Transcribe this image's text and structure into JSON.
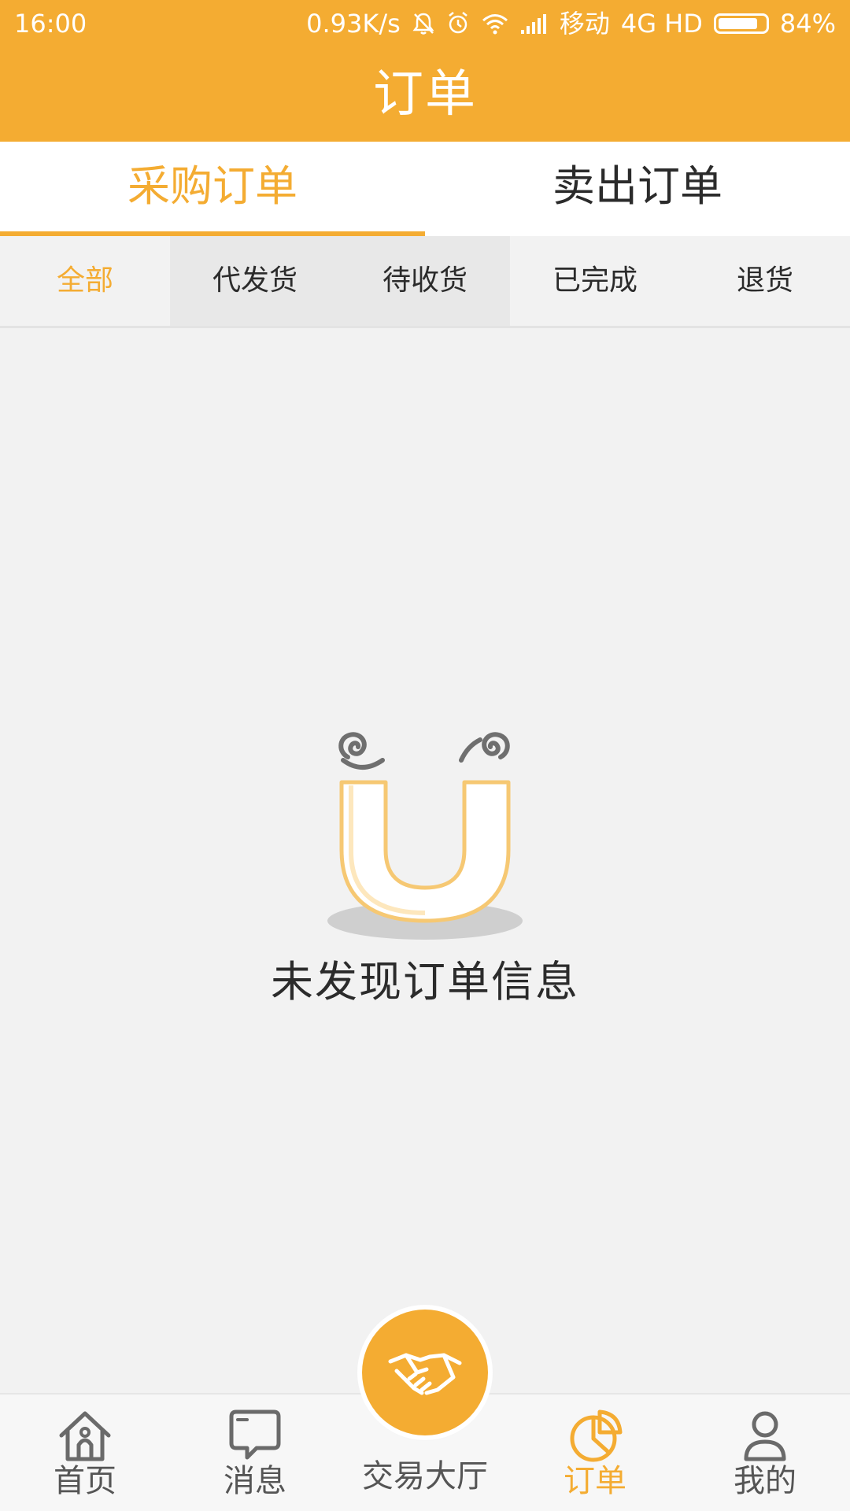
{
  "status_bar": {
    "time": "16:00",
    "net_speed": "0.93K/s",
    "carrier": "移动",
    "network": "4G HD",
    "battery_percent": "84%",
    "battery_level": 0.84
  },
  "header": {
    "title": "订单"
  },
  "main_tabs": [
    {
      "label": "采购订单",
      "active": true
    },
    {
      "label": "卖出订单",
      "active": false
    }
  ],
  "sub_tabs": [
    {
      "label": "全部",
      "active": true
    },
    {
      "label": "代发货",
      "active": false
    },
    {
      "label": "待收货",
      "active": false
    },
    {
      "label": "已完成",
      "active": false
    },
    {
      "label": "退货",
      "active": false
    }
  ],
  "empty_state": {
    "message": "未发现订单信息",
    "illustration": "dizzy-face-icon"
  },
  "bottom_nav": [
    {
      "label": "首页",
      "icon": "home-icon",
      "active": false
    },
    {
      "label": "消息",
      "icon": "message-icon",
      "active": false
    },
    {
      "label": "交易大厅",
      "icon": "handshake-icon",
      "active": false
    },
    {
      "label": "订单",
      "icon": "pie-chart-icon",
      "active": true
    },
    {
      "label": "我的",
      "icon": "user-icon",
      "active": false
    }
  ],
  "colors": {
    "accent": "#f4ac32",
    "text": "#2b2b2b",
    "background": "#f2f2f2"
  }
}
